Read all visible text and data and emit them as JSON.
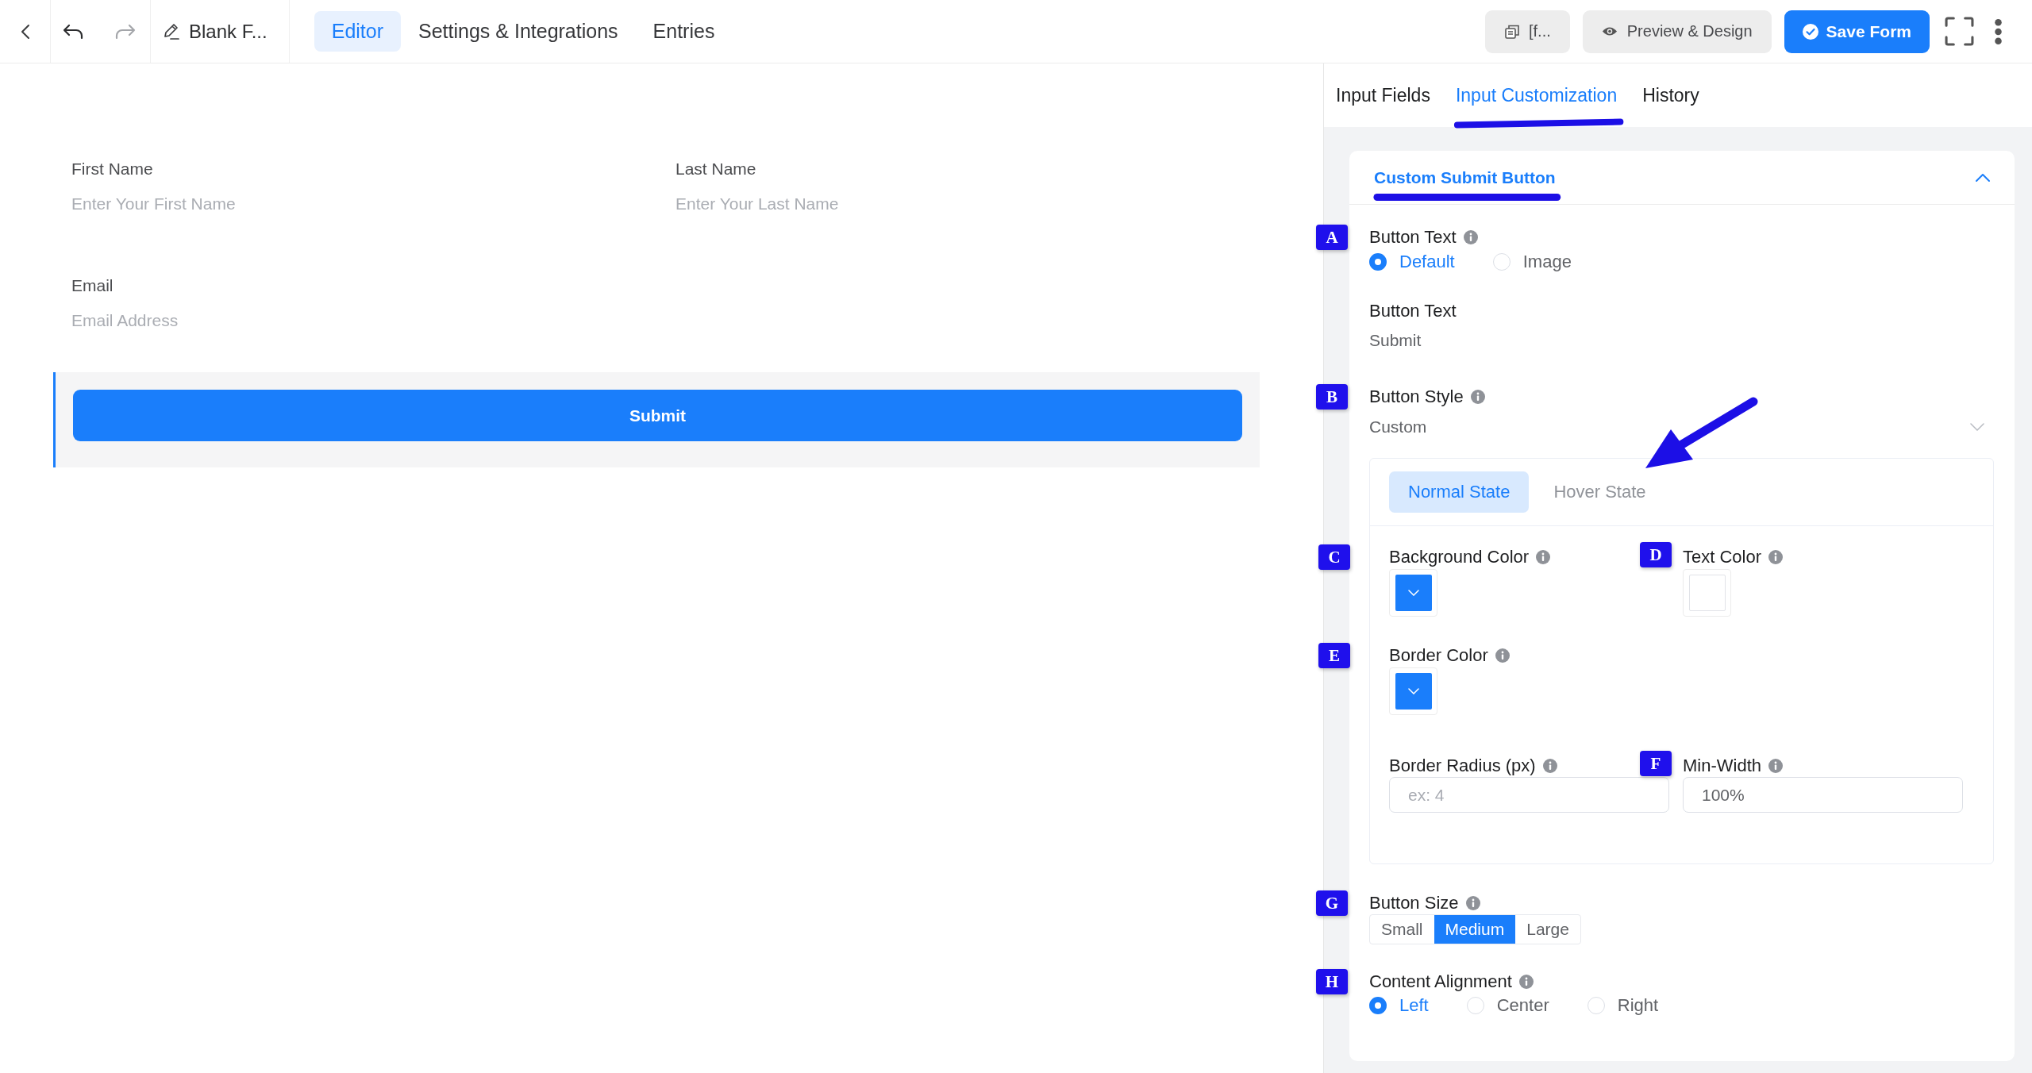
{
  "header": {
    "history_buttons": [
      {
        "kind": "undo",
        "disabled": false
      },
      {
        "kind": "redo",
        "disabled": true
      }
    ],
    "form_title": "Blank F...",
    "tabs": [
      {
        "label": "Editor",
        "selected": true
      },
      {
        "label": "Settings & Integrations",
        "selected": false
      },
      {
        "label": "Entries",
        "selected": false
      }
    ],
    "shortcode_button": "[f...",
    "preview_button": "Preview & Design",
    "save_button": "Save Form"
  },
  "form": {
    "fields": [
      {
        "label": "First Name",
        "placeholder": "Enter Your First Name"
      },
      {
        "label": "Last Name",
        "placeholder": "Enter Your Last Name"
      },
      {
        "label": "Email",
        "placeholder": "Email Address"
      }
    ],
    "submit_button": "Submit"
  },
  "sidebar": {
    "tabs": [
      {
        "label": "Input Fields",
        "selected": false,
        "underlined": false
      },
      {
        "label": "Input Customization",
        "selected": true,
        "underlined": true
      },
      {
        "label": "History",
        "selected": false,
        "underlined": false
      }
    ],
    "section": {
      "title": "Custom Submit Button",
      "underlined": true,
      "expanded": true,
      "button_text_type": {
        "label": "Button Text",
        "badge": "A",
        "options": [
          {
            "label": "Default",
            "selected": true
          },
          {
            "label": "Image",
            "selected": false
          }
        ]
      },
      "button_text": {
        "label": "Button Text",
        "value": "Submit"
      },
      "button_style": {
        "label": "Button Style",
        "badge": "B",
        "value": "Custom"
      },
      "style_states": {
        "tabs": [
          {
            "label": "Normal State",
            "selected": true,
            "arrow": false
          },
          {
            "label": "Hover State",
            "selected": false,
            "arrow": true
          }
        ],
        "colors": [
          {
            "label": "Background Color",
            "badge": "C",
            "color": "#1a7efb"
          },
          {
            "label": "Text Color",
            "badge": "D",
            "color": "#ffffff"
          },
          {
            "label": "Border Color",
            "badge": "E",
            "color": "#1a7efb"
          }
        ],
        "border_radius": {
          "label": "Border Radius (px)",
          "placeholder": "ex: 4"
        },
        "min_width": {
          "label": "Min-Width",
          "badge": "F",
          "value": "100%"
        }
      },
      "button_size": {
        "label": "Button Size",
        "badge": "G",
        "options": [
          {
            "label": "Small",
            "selected": false
          },
          {
            "label": "Medium",
            "selected": true
          },
          {
            "label": "Large",
            "selected": false
          }
        ]
      },
      "content_alignment": {
        "label": "Content Alignment",
        "badge": "H",
        "options": [
          {
            "label": "Left",
            "selected": true
          },
          {
            "label": "Center",
            "selected": false
          },
          {
            "label": "Right",
            "selected": false
          }
        ]
      }
    }
  }
}
